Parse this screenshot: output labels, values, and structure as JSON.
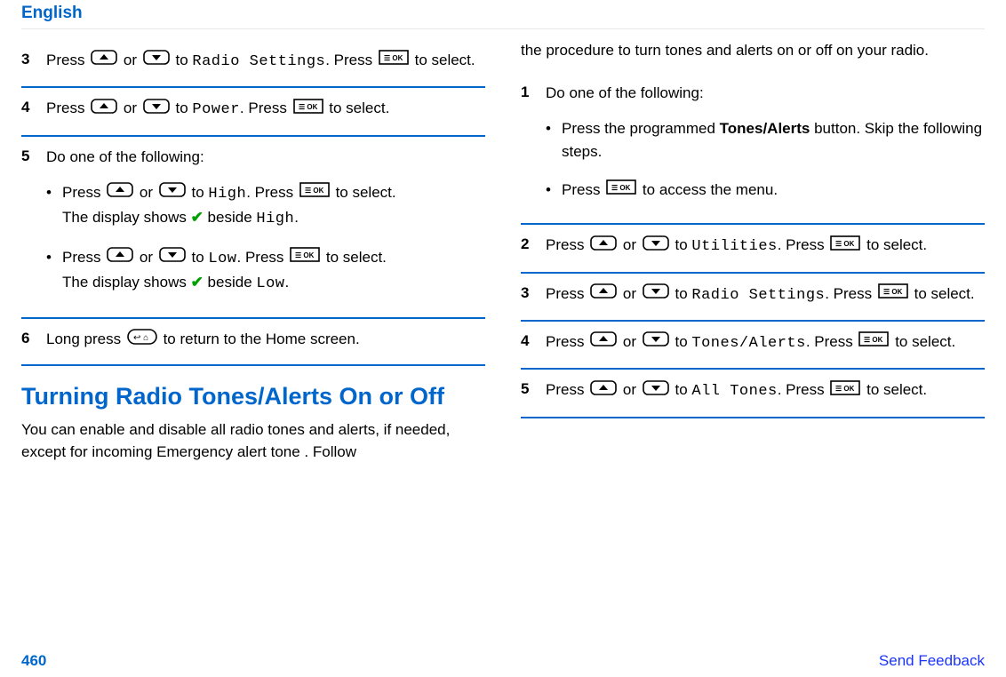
{
  "header": {
    "language": "English"
  },
  "footer": {
    "page": "460",
    "feedback": "Send Feedback"
  },
  "left": {
    "step3": {
      "p1": "Press ",
      "p2": " or ",
      "p3": " to ",
      "menu": "Radio Settings",
      "p4": ". Press ",
      "p5": " to select."
    },
    "step4": {
      "p1": "Press ",
      "p2": " or ",
      "p3": " to ",
      "menu": "Power",
      "p4": ". Press ",
      "p5": " to select."
    },
    "step5": {
      "intro": "Do one of the following:",
      "opt_high": {
        "p1": "Press ",
        "p2": " or ",
        "p3": " to ",
        "menu": "High",
        "p4": ". Press ",
        "p5": " to select.",
        "res1": "The display shows ",
        "res2": " beside ",
        "res_menu": "High",
        "res3": "."
      },
      "opt_low": {
        "p1": "Press ",
        "p2": " or ",
        "p3": " to ",
        "menu": "Low",
        "p4": ". Press ",
        "p5": " to select.",
        "res1": "The display shows ",
        "res2": " beside ",
        "res_menu": "Low",
        "res3": "."
      }
    },
    "step6": {
      "p1": "Long press ",
      "p2": " to return to the Home screen."
    },
    "section_title": "Turning Radio Tones/Alerts On or Off",
    "section_intro": "You can enable and disable all radio tones and alerts, if needed, except for incoming Emergency alert tone . Follow"
  },
  "right": {
    "cont": "the procedure to turn tones and alerts on or off on your radio.",
    "step1": {
      "intro": "Do one of the following:",
      "opt_a": {
        "p1": "Press the programmed ",
        "bold": "Tones/Alerts",
        "p2": " button. Skip the following steps."
      },
      "opt_b": {
        "p1": "Press ",
        "p2": " to access the menu."
      }
    },
    "step2": {
      "p1": "Press ",
      "p2": " or ",
      "p3": " to ",
      "menu": "Utilities",
      "p4": ". Press ",
      "p5": " to select."
    },
    "step3": {
      "p1": "Press ",
      "p2": " or ",
      "p3": " to ",
      "menu": "Radio Settings",
      "p4": ". Press ",
      "p5": " to select."
    },
    "step4": {
      "p1": "Press ",
      "p2": " or ",
      "p3": " to ",
      "menu": "Tones/Alerts",
      "p4": ". Press ",
      "p5": " to select."
    },
    "step5": {
      "p1": "Press ",
      "p2": " or ",
      "p3": " to ",
      "menu": "All Tones",
      "p4": ". Press ",
      "p5": " to select."
    }
  }
}
